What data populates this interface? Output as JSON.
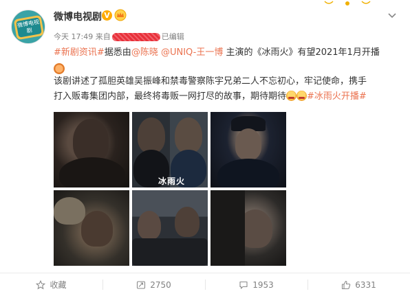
{
  "post": {
    "author": "微博电视剧",
    "verified_mark": "V",
    "time": "今天 17:49 来自",
    "edited": "已编辑",
    "avatar_text": "微博电视剧"
  },
  "content": {
    "tag1": "#新剧资讯#",
    "t1": "据悉由",
    "mention1": "@陈晓",
    "mention2": "@UNIQ-王一博",
    "t2": "主演的《冰雨火》有望2021年1月开播",
    "line3": "该剧讲述了孤胆英雄吴振峰和禁毒警察陈宇兄弟二人不忘初心，牢记使命，携手",
    "line4": "打入贩毒集团内部，最终将毒贩一网打尽的故事，期待期待",
    "tag2": "#冰雨火开播#"
  },
  "photos": {
    "p2_title": "冰雨火"
  },
  "footer": {
    "favorite_label": "收藏",
    "repost_count": "2750",
    "comment_count": "1953",
    "like_count": "6331"
  },
  "colors": {
    "link": "#eb7350",
    "meta": "#808080",
    "badge": "#ffab00"
  },
  "icons": [
    "avatar",
    "verified-badge-icon",
    "crown-icon",
    "chevron-down-icon",
    "star-icon",
    "repost-icon",
    "comment-icon",
    "like-icon"
  ]
}
